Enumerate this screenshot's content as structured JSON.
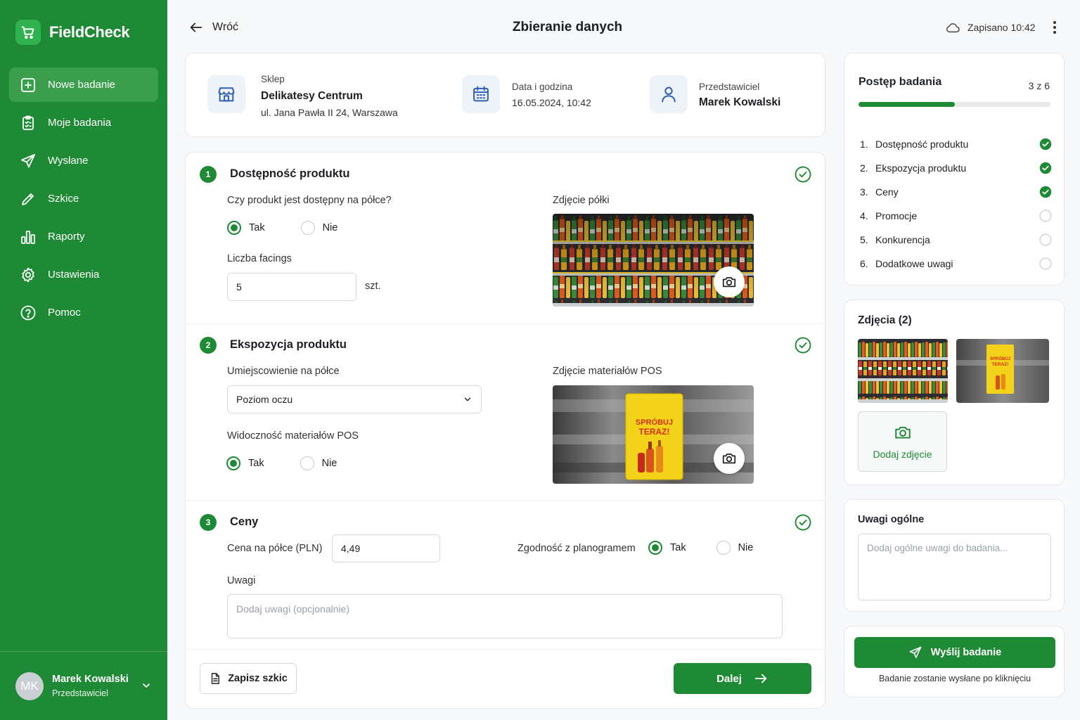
{
  "app": {
    "name": "FieldCheck"
  },
  "colors": {
    "brand": "#1f8a35",
    "brand_active": "#3a9e4c",
    "muted": "#9aa0a6",
    "check": "#1f8a35"
  },
  "sidebar": {
    "items": [
      {
        "label": "Nowe badanie",
        "icon": "plus-square-icon",
        "active": true
      },
      {
        "label": "Moje badania",
        "icon": "clipboard-icon"
      },
      {
        "label": "Wysłane",
        "icon": "send-icon"
      },
      {
        "label": "Szkice",
        "icon": "pencil-icon"
      },
      {
        "label": "Raporty",
        "icon": "bar-chart-icon"
      },
      {
        "label": "Ustawienia",
        "icon": "gear-icon"
      },
      {
        "label": "Pomoc",
        "icon": "help-circle-icon"
      }
    ],
    "user": {
      "initials": "MK",
      "name": "Marek Kowalski",
      "role": "Przedstawiciel"
    }
  },
  "header": {
    "back_label": "Wróć",
    "title": "Zbieranie danych",
    "saved_status": "Zapisano 10:42"
  },
  "info": {
    "store_label": "Sklep",
    "store_name": "Delikatesy Centrum",
    "store_address": "ul. Jana Pawła II 24, Warszawa",
    "datetime_label": "Data i godzina",
    "datetime_value": "16.05.2024, 10:42",
    "rep_label": "Przedstawiciel",
    "rep_name": "Marek Kowalski"
  },
  "sections": {
    "s1": {
      "number": "1",
      "title": "Dostępność produktu",
      "question": "Czy produkt jest dostępny na półce?",
      "yes": "Tak",
      "no": "Nie",
      "selected": "Tak",
      "facings_label": "Liczba facings",
      "facings_value": "5",
      "facings_unit": "szt.",
      "photo_label": "Zdjęcie półki"
    },
    "s2": {
      "number": "2",
      "title": "Ekspozycja produktu",
      "placement_label": "Umiejscowienie na półce",
      "placement_value": "Poziom oczu",
      "visibility_label": "Widoczność materiałów POS",
      "yes": "Tak",
      "no": "Nie",
      "selected": "Tak",
      "photo_label": "Zdjęcie materiałów POS",
      "pos_sign_line1": "SPRÓBUJ",
      "pos_sign_line2": "TERAZ!"
    },
    "s3": {
      "number": "3",
      "title": "Ceny",
      "price_label": "Cena na półce (PLN)",
      "price_value": "4,49",
      "planogram_label": "Zgodność z planogramem",
      "yes": "Tak",
      "no": "Nie",
      "selected": "Tak",
      "notes_label": "Uwagi",
      "notes_placeholder": "Dodaj uwagi (opcjonalnie)"
    }
  },
  "actions": {
    "draft": "Zapisz szkic",
    "next": "Dalej"
  },
  "progress": {
    "title": "Postęp badania",
    "count": "3 z 6",
    "fraction": 0.5,
    "steps": [
      {
        "num": "1.",
        "label": "Dostępność produktu",
        "done": true
      },
      {
        "num": "2.",
        "label": "Ekspozycja produktu",
        "done": true
      },
      {
        "num": "3.",
        "label": "Ceny",
        "done": true
      },
      {
        "num": "4.",
        "label": "Promocje",
        "done": false
      },
      {
        "num": "5.",
        "label": "Konkurencja",
        "done": false
      },
      {
        "num": "6.",
        "label": "Dodatkowe uwagi",
        "done": false
      }
    ]
  },
  "photos": {
    "title": "Zdjęcia (2)",
    "add_label": "Dodaj zdjęcie"
  },
  "general_notes": {
    "title": "Uwagi ogólne",
    "placeholder": "Dodaj ogólne uwagi do badania..."
  },
  "submit": {
    "label": "Wyślij badanie",
    "note": "Badanie zostanie wysłane po kliknięciu"
  }
}
